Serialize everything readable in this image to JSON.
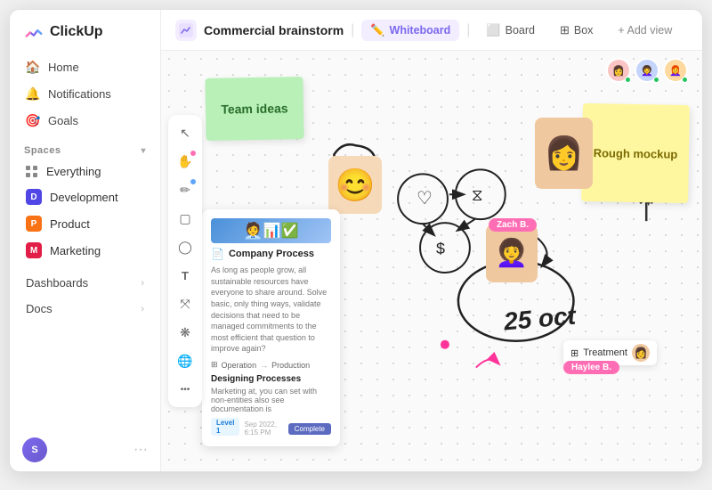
{
  "app": {
    "name": "ClickUp"
  },
  "sidebar": {
    "nav": [
      {
        "id": "home",
        "label": "Home",
        "icon": "🏠"
      },
      {
        "id": "notifications",
        "label": "Notifications",
        "icon": "🔔"
      },
      {
        "id": "goals",
        "label": "Goals",
        "icon": "🎯"
      }
    ],
    "spaces_label": "Spaces",
    "spaces": [
      {
        "id": "everything",
        "label": "Everything",
        "color": null,
        "letter": null
      },
      {
        "id": "development",
        "label": "Development",
        "color": "#4f46e5",
        "letter": "D"
      },
      {
        "id": "product",
        "label": "Product",
        "color": "#f97316",
        "letter": "P"
      },
      {
        "id": "marketing",
        "label": "Marketing",
        "color": "#e11d48",
        "letter": "M"
      }
    ],
    "bottom": [
      {
        "id": "dashboards",
        "label": "Dashboards"
      },
      {
        "id": "docs",
        "label": "Docs"
      }
    ],
    "footer": {
      "avatar_label": "S",
      "more": "···"
    }
  },
  "topbar": {
    "page_icon": "🟣",
    "title": "Commercial brainstorm",
    "tabs": [
      {
        "id": "whiteboard",
        "label": "Whiteboard",
        "icon": "✏️",
        "active": true
      },
      {
        "id": "board",
        "label": "Board",
        "icon": "⬜"
      },
      {
        "id": "box",
        "label": "Box",
        "icon": "⊞"
      },
      {
        "id": "add_view",
        "label": "+ Add view",
        "icon": ""
      }
    ]
  },
  "canvas": {
    "sticky_green": "Team ideas",
    "sticky_yellow": "Rough mockup",
    "doc_title": "Company Process",
    "doc_body": "As long as people grow, all sustainable resources have everyone to share around. Solve basic, only thing ways, validate decisions that need to be managed commitments to the most efficient that question to improve again?",
    "doc_section": "Designing Processes",
    "doc_person_text": "Marketing at, you can set with non-entities also see documentation is",
    "doc_flow_left": "Operation",
    "doc_flow_right": "Production",
    "date_text": "25 oct",
    "zach_label": "Zach B.",
    "haylee_label": "Haylee B.",
    "treatment_label": "Treatment"
  },
  "tools": [
    {
      "id": "select",
      "icon": "↖",
      "active": false,
      "dot": null
    },
    {
      "id": "hand",
      "icon": "✋",
      "active": false,
      "dot": "#ff4f9a"
    },
    {
      "id": "pen",
      "icon": "✏",
      "active": false,
      "dot": "#60a5fa"
    },
    {
      "id": "rect",
      "icon": "▢",
      "active": false,
      "dot": null
    },
    {
      "id": "ellipse",
      "icon": "⬭",
      "active": false,
      "dot": null
    },
    {
      "id": "text",
      "icon": "T",
      "active": false,
      "dot": null
    },
    {
      "id": "connector",
      "icon": "⤧",
      "active": false,
      "dot": null
    },
    {
      "id": "shape",
      "icon": "❋",
      "active": false,
      "dot": null
    },
    {
      "id": "globe",
      "icon": "🌐",
      "active": false,
      "dot": null
    },
    {
      "id": "more2",
      "icon": "•••",
      "active": false,
      "dot": null
    }
  ]
}
